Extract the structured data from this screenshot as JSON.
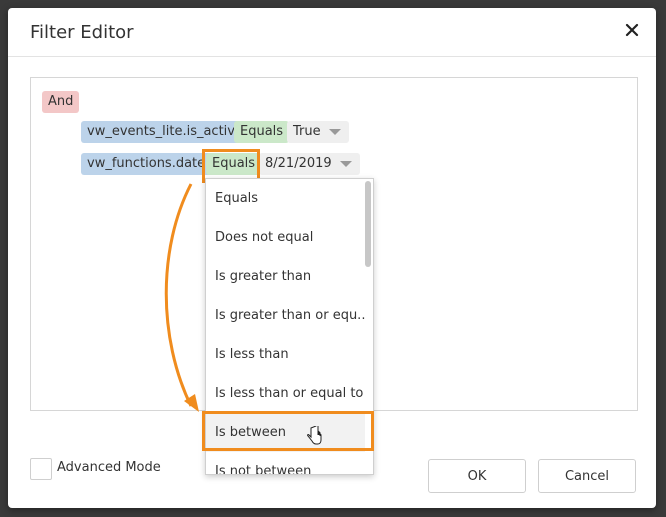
{
  "dialog": {
    "title": "Filter Editor",
    "close_icon": "close-icon"
  },
  "filter": {
    "group_operator": "And",
    "conditions": [
      {
        "field": "vw_events_lite.is_active",
        "operator": "Equals",
        "value": "True"
      },
      {
        "field": "vw_functions.date",
        "operator": "Equals",
        "value": "8/21/2019"
      }
    ]
  },
  "operator_dropdown": {
    "items": [
      "Equals",
      "Does not equal",
      "Is greater than",
      "Is greater than or equ...",
      "Is less than",
      "Is less than or equal to",
      "Is between",
      "Is not between"
    ],
    "hovered": "Is between"
  },
  "footer": {
    "advanced_mode_label": "Advanced Mode",
    "ok_label": "OK",
    "cancel_label": "Cancel"
  },
  "colors": {
    "highlight": "#f08c1e",
    "and_chip": "#f3c7c7",
    "field_chip": "#bcd3ea",
    "operator_chip": "#cbe8c9"
  }
}
